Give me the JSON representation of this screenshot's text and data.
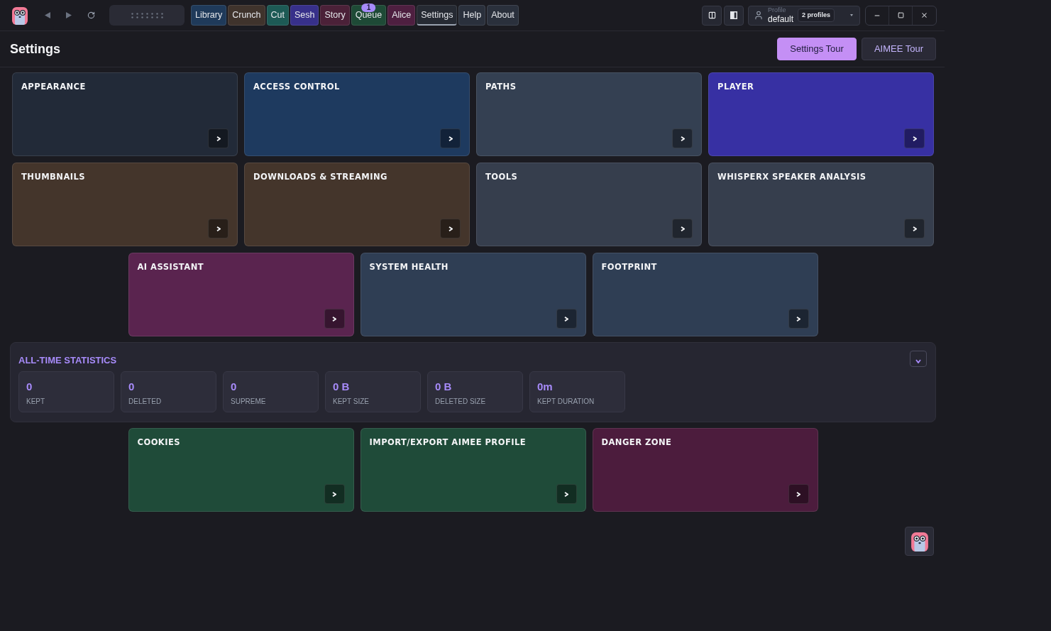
{
  "tabs": [
    {
      "label": "Library",
      "color": "#1f3a5a",
      "selected": false
    },
    {
      "label": "Crunch",
      "color": "#3f332c",
      "selected": false
    },
    {
      "label": "Cut",
      "color": "#1d5a55",
      "selected": false
    },
    {
      "label": "Sesh",
      "color": "#37308a",
      "selected": false
    },
    {
      "label": "Story",
      "color": "#4b2138",
      "selected": false
    },
    {
      "label": "Queue",
      "color": "#1e4a36",
      "selected": false,
      "badge": "1"
    },
    {
      "label": "Alice",
      "color": "#4e1f40",
      "selected": false
    },
    {
      "label": "Settings",
      "color": "#262a33",
      "selected": true
    },
    {
      "label": "Help",
      "color": "#2a303c",
      "selected": false
    },
    {
      "label": "About",
      "color": "#2a303c",
      "selected": false
    }
  ],
  "profile": {
    "label": "Profile",
    "value": "default",
    "count": "2 profiles"
  },
  "page": {
    "title": "Settings",
    "buttons": [
      {
        "label": "Settings Tour",
        "kind": "primary"
      },
      {
        "label": "AIMEE Tour",
        "kind": "secondary"
      }
    ]
  },
  "sections": [
    {
      "title": "APPEARANCE",
      "color": "#222a38"
    },
    {
      "title": "ACCESS CONTROL",
      "color": "#1e3a5f"
    },
    {
      "title": "PATHS",
      "color": "#344052"
    },
    {
      "title": "PLAYER",
      "color": "#3730a3"
    },
    {
      "title": "THUMBNAILS",
      "color": "#44352b"
    },
    {
      "title": "DOWNLOADS & STREAMING",
      "color": "#44352b"
    },
    {
      "title": "TOOLS",
      "color": "#363e4d"
    },
    {
      "title": "WHISPERX SPEAKER ANALYSIS",
      "color": "#363e4d"
    },
    {
      "title": "AI ASSISTANT",
      "color": "#5a244f"
    },
    {
      "title": "SYSTEM HEALTH",
      "color": "#2f3e54"
    },
    {
      "title": "FOOTPRINT",
      "color": "#2f3e54"
    }
  ],
  "statistics": {
    "title": "ALL-TIME STATISTICS",
    "items": [
      {
        "value": "0",
        "label": "KEPT"
      },
      {
        "value": "0",
        "label": "DELETED"
      },
      {
        "value": "0",
        "label": "SUPREME"
      },
      {
        "value": "0 B",
        "label": "KEPT SIZE"
      },
      {
        "value": "0 B",
        "label": "DELETED SIZE"
      },
      {
        "value": "0m",
        "label": "KEPT DURATION"
      }
    ]
  },
  "bottom_sections": [
    {
      "title": "COOKIES",
      "color": "#1f4b39"
    },
    {
      "title": "IMPORT/EXPORT AIMEE PROFILE",
      "color": "#1f4b39"
    },
    {
      "title": "DANGER ZONE",
      "color": "#4c1c3d"
    }
  ]
}
